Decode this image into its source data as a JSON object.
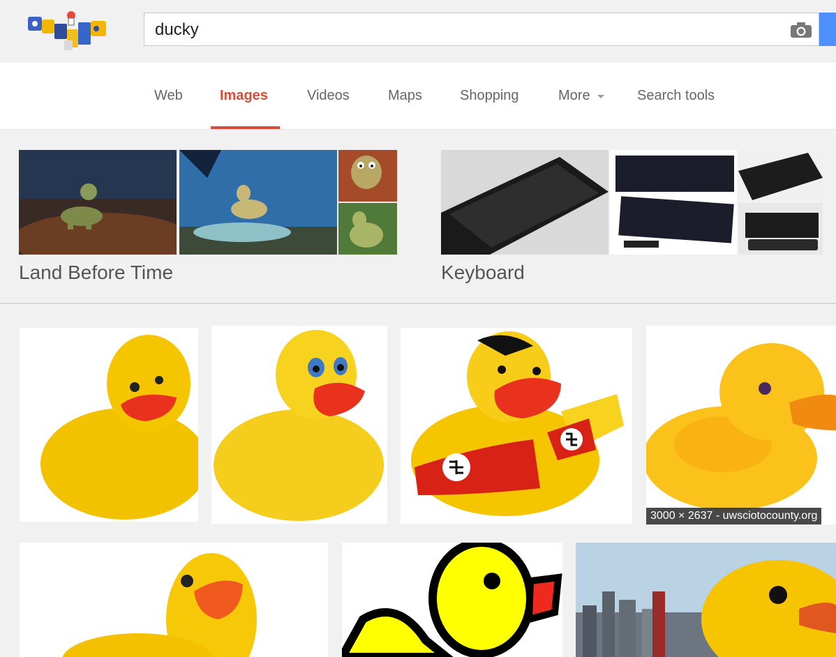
{
  "search": {
    "query": "ducky"
  },
  "nav": {
    "web": "Web",
    "images": "Images",
    "videos": "Videos",
    "maps": "Maps",
    "shopping": "Shopping",
    "more": "More",
    "search_tools": "Search tools",
    "active": "Images"
  },
  "related": [
    {
      "label": "Land Before Time"
    },
    {
      "label": "Keyboard"
    }
  ],
  "results": [
    {
      "info": ""
    },
    {
      "info": ""
    },
    {
      "info": ""
    },
    {
      "info": "3000 × 2637 - uwsciotocounty.org"
    },
    {
      "info": ""
    },
    {
      "info": ""
    },
    {
      "info": ""
    }
  ],
  "colors": {
    "accent": "#dd4b39",
    "search_button": "#4d90fe",
    "duck_yellow": "#f5c400",
    "beak_red": "#e8321e"
  },
  "icons": {
    "camera": "camera-icon",
    "caret": "chevron-down-icon"
  }
}
